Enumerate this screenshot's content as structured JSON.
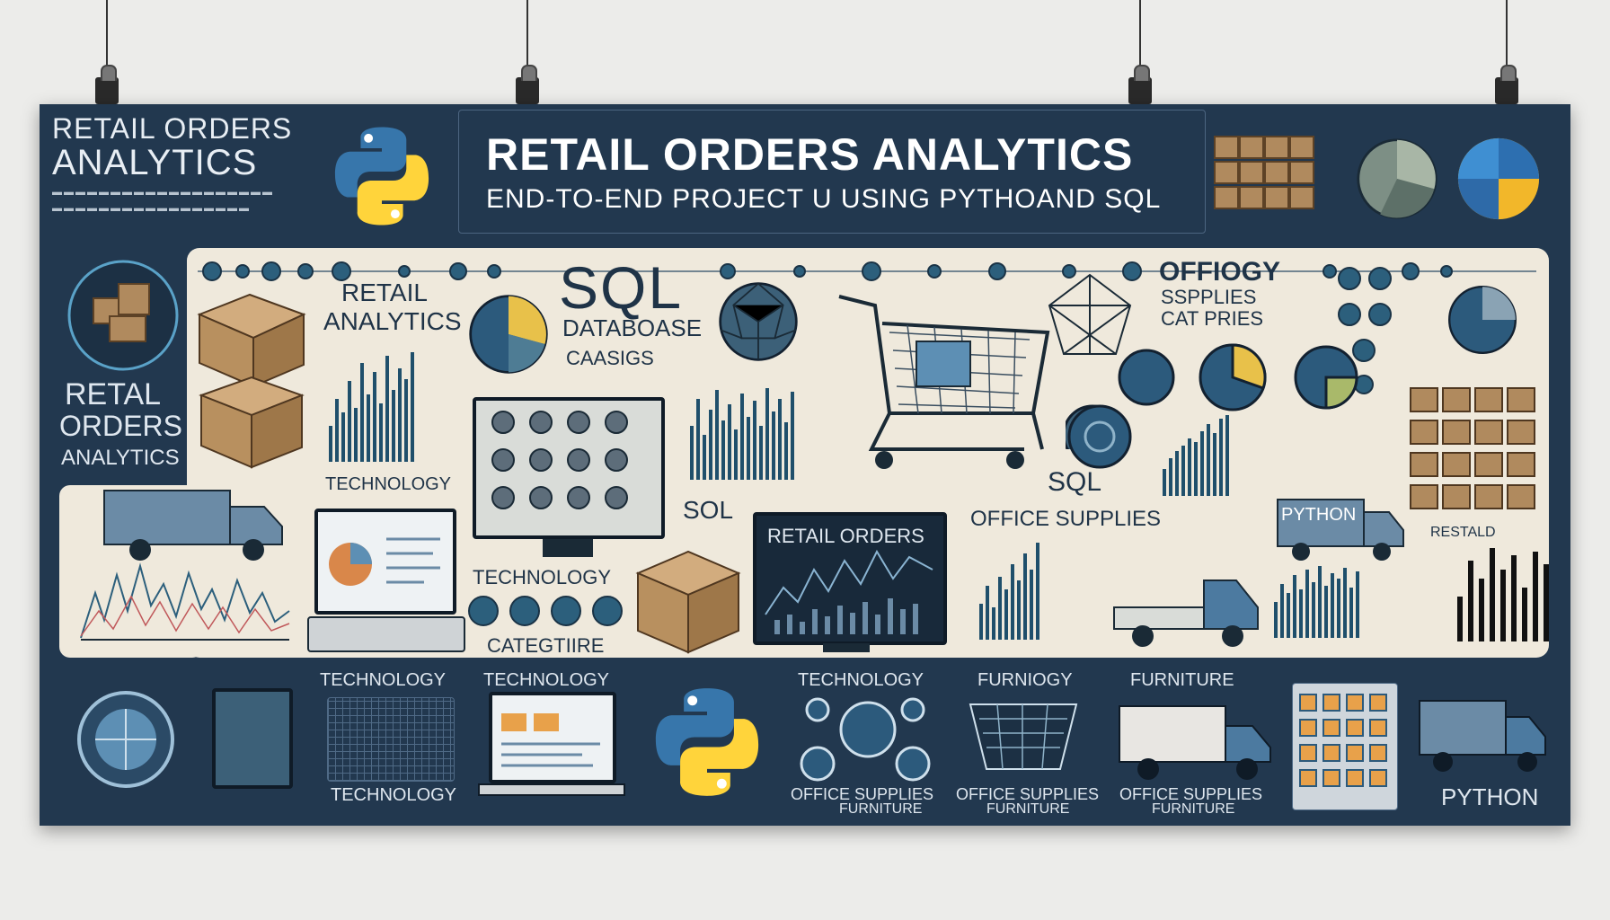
{
  "header": {
    "left_title_line1": "RETAIL ORDERS",
    "left_title_line2": "ANALYTICS",
    "main_title": "RETAIL ORDERS ANALYTICS",
    "main_subtitle": "END-TO-END PROJECT U USING PYTHOAND SQL"
  },
  "side": {
    "title_line1": "RETAL",
    "title_line2": "ORDERS",
    "title_line3": "ANALYTICS"
  },
  "panel": {
    "retail_analytics_1": "RETAIL",
    "retail_analytics_2": "ANALYTICS",
    "sql_big": "SQL",
    "database": "DATABOASE",
    "cassigs": "CAASIGS",
    "offiogy": "OFFIOGY",
    "supplies": "SSPPLIES",
    "catpries": "CAT PRIES",
    "technology": "TECHNOLOGY",
    "technology2": "TECHNOLOGY",
    "categtiire": "CATEGTIIRE",
    "sql_small": "SOL",
    "retail_orders": "RETAIL ORDERS",
    "sql_right": "SQL",
    "office_supplies": "OFFICE SUPPLIES",
    "python": "PYTHON",
    "restald": "RESTALD"
  },
  "bottom": {
    "technology_a": "TECHNOLOGY",
    "technology_b": "TECHNOLOGY",
    "technology_c": "TECHNOLOGY",
    "technology_d": "TECHNOLOGY",
    "furniogy": "FURNIOGY",
    "furniture_a": "FURNITURE",
    "office_supplies_a": "OFFICE SUPPLIES",
    "office_supplies_b": "OFFICE SUPPLIES",
    "office_supplies_c": "OFFICE SUPPLIES",
    "furniture_b": "FURNITURE",
    "furniture_c": "FURNITURE",
    "furniture_d": "FURNITURE",
    "python": "PYTHON"
  },
  "colors": {
    "banner": "#22384f",
    "panel": "#efe9dc",
    "python_blue": "#3776ab",
    "python_yellow": "#ffd43b",
    "box": "#b08a5e"
  }
}
